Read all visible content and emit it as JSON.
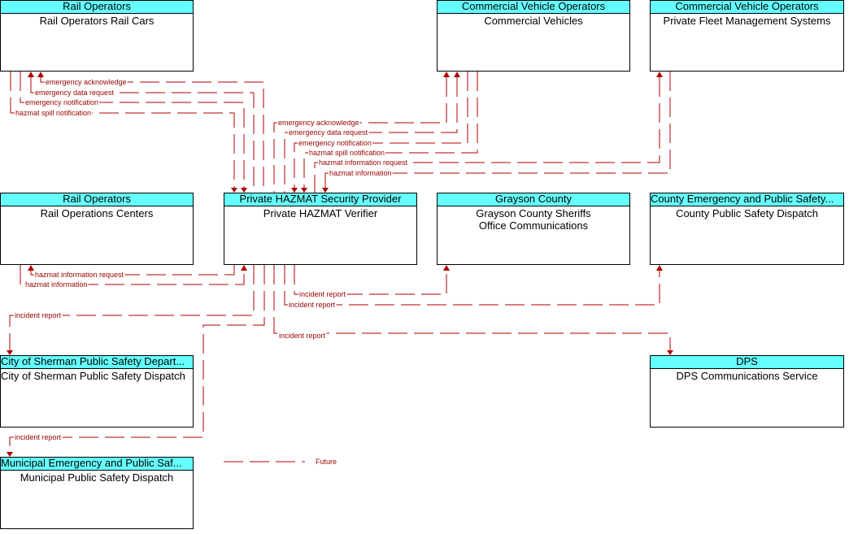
{
  "colors": {
    "future_line": "#b00000",
    "header_fill": "#66ffff",
    "label": "#990000"
  },
  "nodes": {
    "rail_cars": {
      "owner": "Rail Operators",
      "name": "Rail Operators Rail Cars"
    },
    "commercial_vehicles": {
      "owner": "Commercial Vehicle Operators",
      "name": "Commercial Vehicles"
    },
    "fleet_mgmt": {
      "owner": "Commercial Vehicle Operators",
      "name": "Private Fleet Management Systems"
    },
    "rail_ops_centers": {
      "owner": "Rail Operators",
      "name": "Rail Operations Centers"
    },
    "hazmat_verifier": {
      "owner": "Private HAZMAT Security Provider",
      "name": "Private HAZMAT Verifier"
    },
    "grayson_sheriff": {
      "owner": "Grayson County",
      "name": "Grayson County Sheriffs Office Communications"
    },
    "county_dispatch": {
      "owner": "County Emergency and Public Safety...",
      "name": "County Public Safety Dispatch"
    },
    "sherman_dispatch": {
      "owner": "City of Sherman Public Safety Depart...",
      "name": "City of Sherman Public Safety Dispatch"
    },
    "dps": {
      "owner": "DPS",
      "name": "DPS Communications Service"
    },
    "municipal_dispatch": {
      "owner": "Municipal Emergency and Public Saf...",
      "name": "Municipal Public Safety Dispatch"
    }
  },
  "flows": {
    "railcars_ack": "emergency acknowledge",
    "railcars_datareq": "emergency data request",
    "railcars_notif": "emergency notification",
    "railcars_spill": "hazmat spill notification",
    "cv_ack": "emergency acknowledge",
    "cv_datareq": "emergency data request",
    "cv_notif": "emergency notification",
    "cv_spill": "hazmat spill notification",
    "fleet_inforeq": "hazmat information request",
    "fleet_info": "hazmat information",
    "roc_inforeq": "hazmat information request",
    "roc_info": "hazmat information",
    "grayson_incident": "incident report",
    "county_incident": "incident report",
    "sherman_incident": "incident report",
    "dps_incident": "incident report",
    "municipal_incident": "incident report"
  },
  "legend": {
    "future_label": "Future"
  }
}
